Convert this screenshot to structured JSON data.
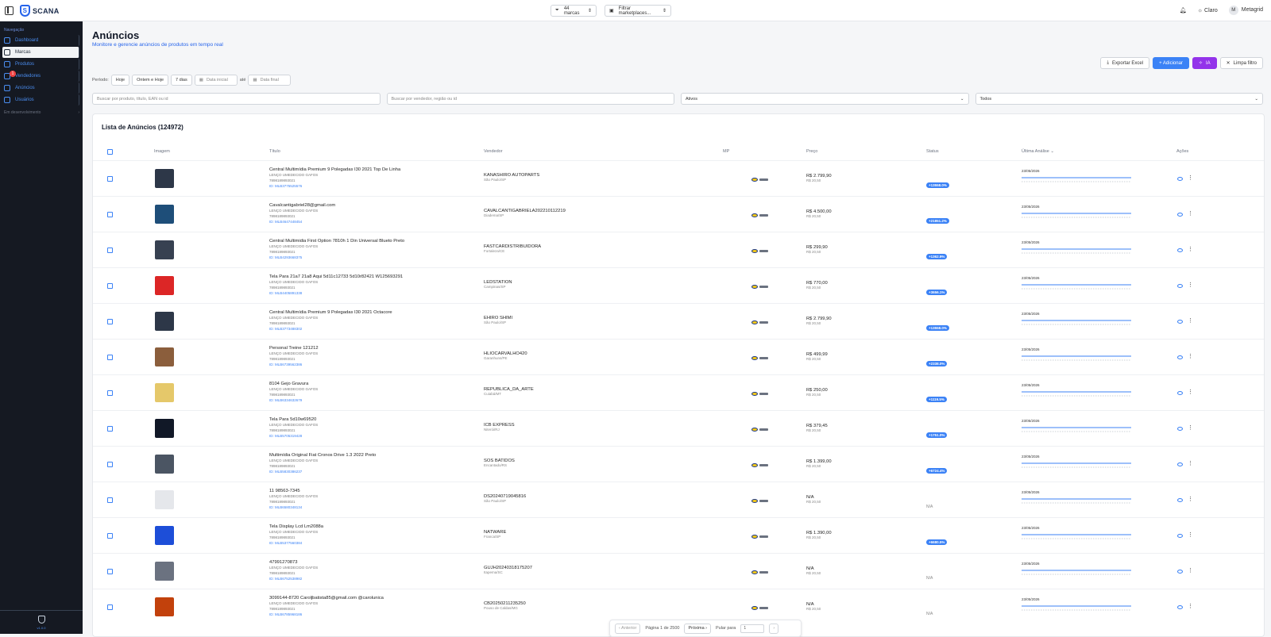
{
  "topbar": {
    "brand": "SCANA",
    "brands_filter": "44 marcas",
    "marketplace_filter": "Filtrar marketplaces...",
    "theme": "Claro",
    "user_initial": "M",
    "user_name": "Metagrid"
  },
  "sidebar": {
    "section": "Navegação",
    "items": [
      {
        "label": "Dashboard",
        "icon": "home-icon"
      },
      {
        "label": "Marcas",
        "icon": "tag-icon"
      },
      {
        "label": "Produtos",
        "icon": "box-icon"
      },
      {
        "label": "Vendedores",
        "icon": "user-group-icon",
        "badge": "1"
      },
      {
        "label": "Anúncios",
        "icon": "megaphone-icon"
      },
      {
        "label": "Usuários",
        "icon": "users-icon"
      }
    ],
    "dev": "Em desenvolvimento",
    "version": "v1.0.0"
  },
  "page": {
    "title": "Anúncios",
    "subtitle": "Monitore e gerencie anúncios de produtos em tempo real"
  },
  "actions": {
    "export": "Exportar Excel",
    "add": "+ Adicionar",
    "ia": "IA",
    "clear": "Limpa filtro"
  },
  "period": {
    "label": "Período:",
    "today": "Hoje",
    "yesterday_today": "Ontem e Hoje",
    "seven_days": "7 dias",
    "start_placeholder": "Data inicial",
    "to": "até",
    "end_placeholder": "Data final"
  },
  "filters": {
    "product_placeholder": "Buscar por produto, título, EAN ou id",
    "seller_placeholder": "Buscar por vendedor, região ou id",
    "active": "Ativos",
    "all": "Todos"
  },
  "table": {
    "title": "Lista de Anúncios (124972)",
    "headers": {
      "image": "Imagem",
      "title": "Título",
      "seller": "Vendedor",
      "mp": "MP",
      "price": "Preço",
      "status": "Status",
      "last": "Última Análise",
      "actions": "Ações"
    },
    "brand_line": "LENÇO UMEDECIDO GAFOS",
    "ean": "7898189893021",
    "rows": [
      {
        "title": "Central Multimídia Premium 9 Polegadas I30 2021 Top De Linha",
        "id": "ID: MLB3775525576",
        "seller": "KANASHIRO AUTOPARTS",
        "city": "São Paulo/SP",
        "price": "R$ 2.799,90",
        "price2": "R$ 20,50",
        "status": "+13558.0%",
        "date": "23/05/2026",
        "thumb": "#2d3748"
      },
      {
        "title": "Cavalcantigabriel28@gmail.com",
        "id": "ID: MLB4647448454",
        "seller": "CAVALCANTIGABRIELA202210112219",
        "city": "Diadema/SP",
        "price": "R$ 4.500,00",
        "price2": "R$ 20,50",
        "status": "+21851.2%",
        "date": "23/05/2026",
        "thumb": "#1e4e79"
      },
      {
        "title": "Central Multimidia First Option 7810h 1 Din Universal Blueto Preto",
        "id": "ID: MLB4293668375",
        "seller": "FASTCARDISTRIBUIDORA",
        "city": "Fortaleza/CE",
        "price": "R$ 299,90",
        "price2": "R$ 20,50",
        "status": "+1362.9%",
        "date": "23/05/2026",
        "thumb": "#374151"
      },
      {
        "title": "Tela Para 21a7 21a8 Aqui 5d11c12733 5d10r82421 W125693291",
        "id": "ID: MLB4405891338",
        "seller": "LEDSTATION",
        "city": "Campinas/SP",
        "price": "R$ 770,00",
        "price2": "R$ 20,50",
        "status": "+3656.1%",
        "date": "23/05/2026",
        "thumb": "#dc2626"
      },
      {
        "title": "Central Multimídia Premium 9 Polegadas I30 2021 Octacore",
        "id": "ID: MLB3773488302",
        "seller": "EHIRO SHIMI",
        "city": "São Paulo/SP",
        "price": "R$ 2.799,90",
        "price2": "R$ 20,50",
        "status": "+13558.0%",
        "date": "23/05/2026",
        "thumb": "#2d3748"
      },
      {
        "title": "Personal Treine 121212",
        "id": "ID: MLB6739562386",
        "seller": "HLIOCARVALHO420",
        "city": "Garanhuns/PE",
        "price": "R$ 499,99",
        "price2": "R$ 20,50",
        "status": "+2338.0%",
        "date": "23/05/2026",
        "thumb": "#8b5e3c"
      },
      {
        "title": "8104 Gejo Gravura",
        "id": "ID: MLB6334632679",
        "seller": "REPUBLICA_DA_ARTE",
        "city": "Cuiabá/MT",
        "price": "R$ 250,00",
        "price2": "R$ 20,50",
        "status": "+1119.5%",
        "date": "23/05/2026",
        "thumb": "#e5c86a"
      },
      {
        "title": "Tela Para 5d10w69520",
        "id": "ID: MLB5705319428",
        "seller": "ICB EXPRESS",
        "city": "Niterói/RJ",
        "price": "R$ 379,45",
        "price2": "R$ 20,50",
        "status": "+1751.0%",
        "date": "23/05/2026",
        "thumb": "#111827"
      },
      {
        "title": "Multimídia Original Fiat Cronos Drive 1.3 2022 Preto",
        "id": "ID: MLB5830386237",
        "seller": "SOS BATIDOS",
        "city": "Encantado/RS",
        "price": "R$ 1.399,00",
        "price2": "R$ 20,50",
        "status": "+6724.4%",
        "date": "23/05/2026",
        "thumb": "#4b5563"
      },
      {
        "title": "11 98563-7345",
        "id": "ID: MLB6580348134",
        "seller": "DS20240719045816",
        "city": "São Paulo/SP",
        "price": "N/A",
        "price2": "R$ 20,50",
        "status": "N/A",
        "date": "23/05/2026",
        "thumb": "#e5e7eb"
      },
      {
        "title": "Tela Display Lcd Lm2088a",
        "id": "ID: MLB5377560384",
        "seller": "NATWARE",
        "city": "Franca/SP",
        "price": "R$ 1.390,00",
        "price2": "R$ 20,50",
        "status": "+6680.5%",
        "date": "23/05/2026",
        "thumb": "#1d4ed8"
      },
      {
        "title": "47991270873",
        "id": "ID: MLB6752538982",
        "seller": "GUJH20240318175207",
        "city": "Itapema/SC",
        "price": "N/A",
        "price2": "R$ 20,50",
        "status": "N/A",
        "date": "23/05/2026",
        "thumb": "#6b7280"
      },
      {
        "title": "3099144-8720 Caroljbatista85@gmail.com @carolunica",
        "id": "ID: MLB6785968186",
        "seller": "CB20250211235250",
        "city": "Pouso de Caldas/MG",
        "price": "N/A",
        "price2": "R$ 20,50",
        "status": "N/A",
        "date": "23/05/2026",
        "thumb": "#c2410c"
      }
    ]
  },
  "pager": {
    "prev": "‹ Anterior",
    "page": "Página 1 de 2500",
    "next": "Próxima ›",
    "jump": "Pular para",
    "jump_value": "1",
    "go": "›"
  },
  "colors": {
    "accent": "#3b82f6",
    "sidebar": "#151922",
    "ia": "#9333ea"
  }
}
